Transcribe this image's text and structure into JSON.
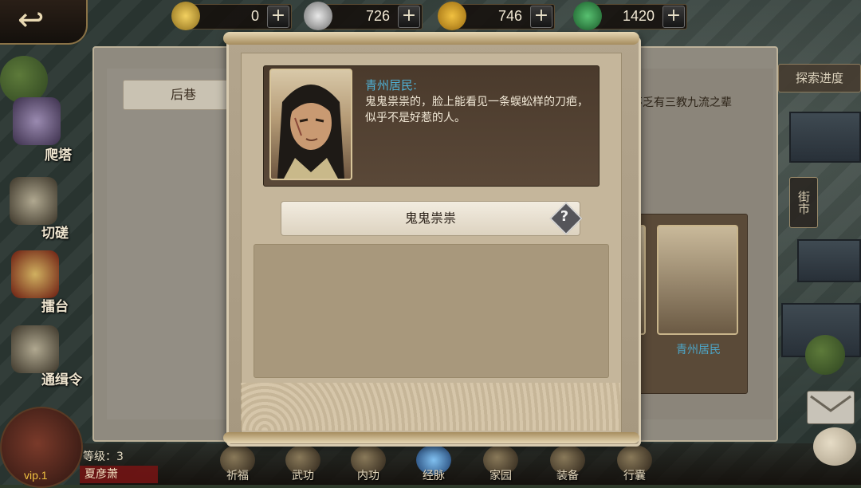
{
  "resources": [
    {
      "icon": "gold-ingot-icon",
      "value": "0"
    },
    {
      "icon": "silver-ingot-icon",
      "value": "726"
    },
    {
      "icon": "coin-icon",
      "value": "746"
    },
    {
      "icon": "jade-icon",
      "value": "1420"
    }
  ],
  "plus_label": "+",
  "back_label": "↩",
  "panel": {
    "tab_label": "后巷",
    "progress_button": "探索进度",
    "hint_text": "不乏有三教九流之辈",
    "npc_name": "青州居民",
    "street_sign": "街市"
  },
  "side_menu": [
    {
      "icon": "pagoda-icon",
      "label": "爬塔"
    },
    {
      "icon": "pagoda-gate-icon",
      "label": "切磋"
    },
    {
      "icon": "drum-icon",
      "label": "擂台"
    },
    {
      "icon": "wanted-icon",
      "label": "通缉令"
    }
  ],
  "player": {
    "level": "等级：3",
    "name": "夏彦萧",
    "vip": "vip.1"
  },
  "bottom_menu": [
    "祈福",
    "武功",
    "内功",
    "经脉",
    "家园",
    "装备",
    "行囊"
  ],
  "dialog": {
    "title": "青州居民:",
    "description": "鬼鬼祟祟的，脸上能看见一条蜈蚣样的刀疤，似乎不是好惹的人。",
    "choice": "鬼鬼祟祟",
    "help": "?"
  },
  "colors": {
    "accent_text": "#4fb0d4",
    "panel_dark": "#4a3a2c"
  }
}
